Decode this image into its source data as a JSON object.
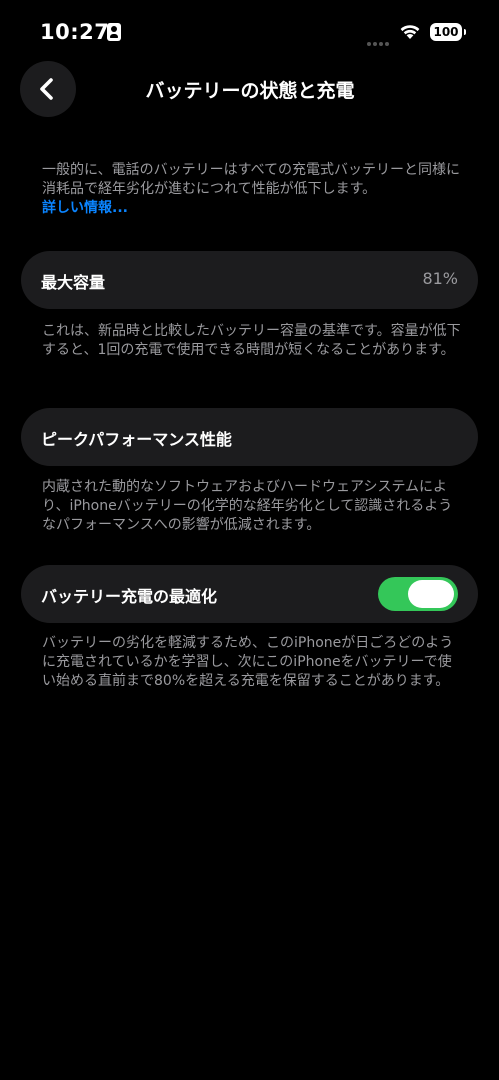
{
  "status_bar": {
    "time": "10:27",
    "battery_level": "100",
    "icons": [
      "id-card-icon",
      "cellular-dots-icon",
      "wifi-icon",
      "battery-icon"
    ]
  },
  "nav": {
    "title": "バッテリーの状態と充電",
    "back_icon": "chevron-left-icon"
  },
  "intro": {
    "text": "一般的に、電話のバッテリーはすべての充電式バッテリーと同様に消耗品で経年劣化が進むにつれて性能が低下します。",
    "link": "詳しい情報..."
  },
  "max_capacity": {
    "label": "最大容量",
    "value": "81%",
    "description": "これは、新品時と比較したバッテリー容量の基準です。容量が低下すると、1回の充電で使用できる時間が短くなることがあります。"
  },
  "peak_performance": {
    "label": "ピークパフォーマンス性能",
    "description": "内蔵された動的なソフトウェアおよびハードウェアシステムにより、iPhoneバッテリーの化学的な経年劣化として認識されるようなパフォーマンスへの影響が低減されます。"
  },
  "optimized_charging": {
    "label": "バッテリー充電の最適化",
    "enabled": true,
    "toggle_color": "#34c759",
    "description": "バッテリーの劣化を軽減するため、このiPhoneが日ごろどのように充電されているかを学習し、次にこのiPhoneをバッテリーで使い始める直前まで80%を超える充電を保留することがあります。"
  },
  "colors": {
    "background": "#000000",
    "cell": "#1c1c1e",
    "secondary_text": "#9a9a9e",
    "link": "#0a84ff"
  }
}
